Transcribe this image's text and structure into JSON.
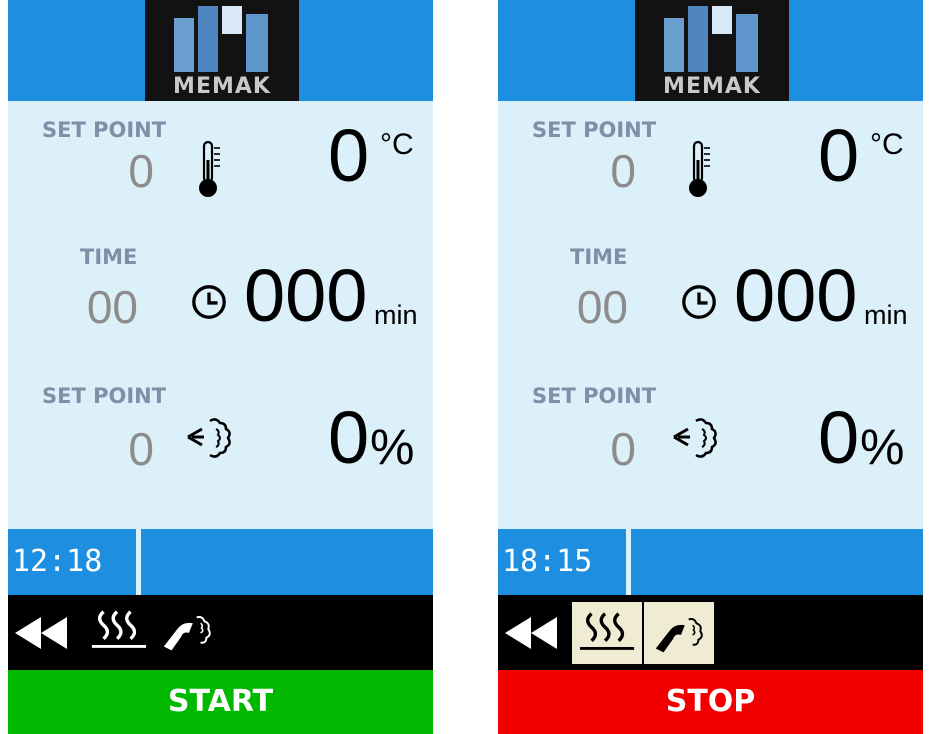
{
  "brand": {
    "logo_text": "MEMAK"
  },
  "panels": [
    {
      "temperature": {
        "label": "SET POINT",
        "set_value": "0",
        "current_value": "0",
        "unit": "°C",
        "icon": "thermometer-icon"
      },
      "time": {
        "label": "TIME",
        "set_value": "00",
        "current_value": "000",
        "unit": "min",
        "icon": "clock-icon"
      },
      "humidity": {
        "label": "SET POINT",
        "set_value": "0",
        "current_value": "0",
        "unit": "%",
        "icon": "steam-icon"
      },
      "clock": "12:18",
      "toolbar": {
        "icons": [
          "rewind-icon",
          "heat-mode-icon",
          "steam-injection-icon"
        ],
        "selected": false
      },
      "action_button": {
        "label": "START",
        "color": "#00b800"
      }
    },
    {
      "temperature": {
        "label": "SET POINT",
        "set_value": "0",
        "current_value": "0",
        "unit": "°C",
        "icon": "thermometer-icon"
      },
      "time": {
        "label": "TIME",
        "set_value": "00",
        "current_value": "000",
        "unit": "min",
        "icon": "clock-icon"
      },
      "humidity": {
        "label": "SET POINT",
        "set_value": "0",
        "current_value": "0",
        "unit": "%",
        "icon": "steam-icon"
      },
      "clock": "18:15",
      "toolbar": {
        "icons": [
          "rewind-icon",
          "heat-mode-icon",
          "steam-injection-icon"
        ],
        "selected": true
      },
      "action_button": {
        "label": "STOP",
        "color": "#f20000"
      }
    }
  ],
  "colors": {
    "header_blue": "#1e8fe0",
    "panel_bg": "#dcf0fa",
    "label_gray_blue": "#7e8fa8",
    "setpoint_gray": "#8c8c8c",
    "toolbar_black": "#000000",
    "start_green": "#00b800",
    "stop_red": "#f20000"
  }
}
